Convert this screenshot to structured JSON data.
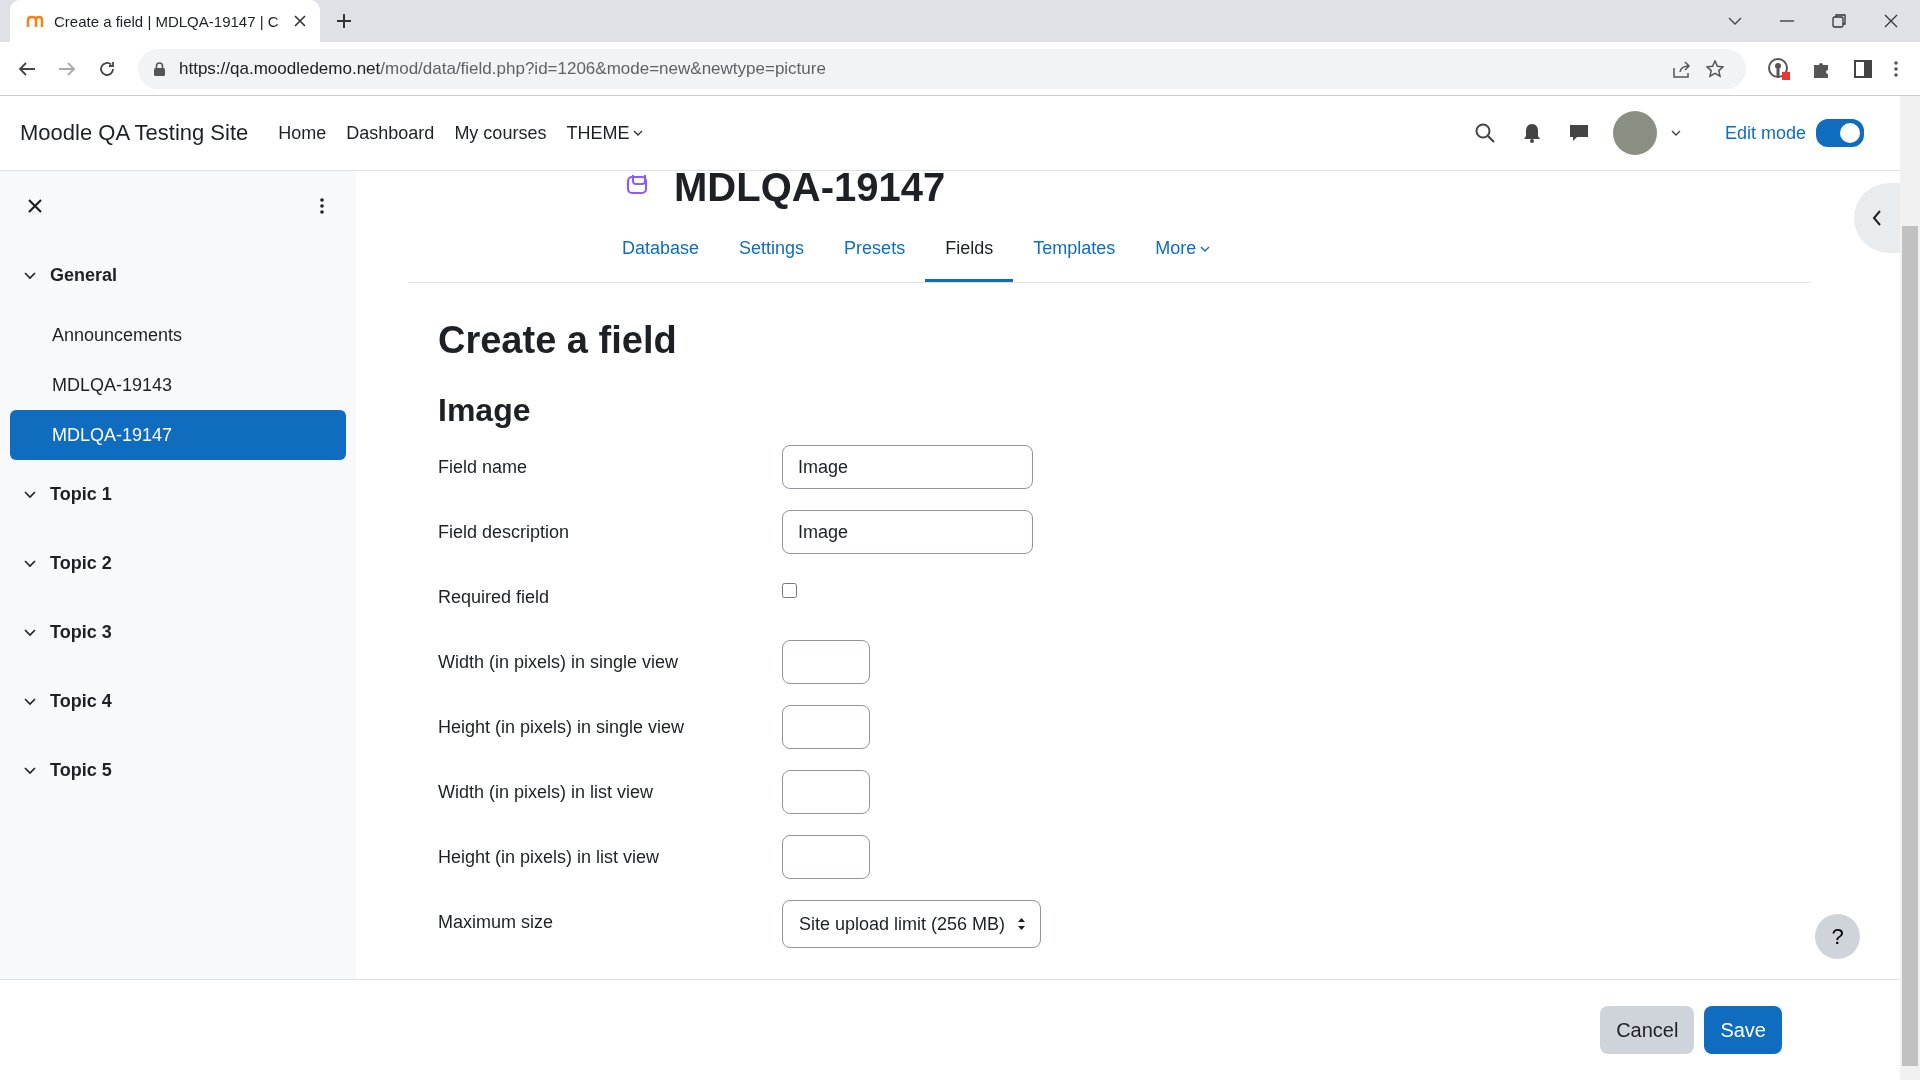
{
  "browser": {
    "tab_title": "Create a field | MDLQA-19147 | C",
    "url_host": "https://qa.moodledemo.net",
    "url_path": "/mod/data/field.php?id=1206&mode=new&newtype=picture"
  },
  "navbar": {
    "site_name": "Moodle QA Testing Site",
    "items": [
      {
        "label": "Home",
        "dropdown": false
      },
      {
        "label": "Dashboard",
        "dropdown": false
      },
      {
        "label": "My courses",
        "dropdown": false
      },
      {
        "label": "THEME",
        "dropdown": true
      }
    ],
    "edit_mode": {
      "label": "Edit mode",
      "on": true
    }
  },
  "sidebar": {
    "items": [
      {
        "kind": "section",
        "label": "General",
        "expanded": true,
        "selected": false
      },
      {
        "kind": "activity",
        "label": "Announcements",
        "selected": false
      },
      {
        "kind": "activity",
        "label": "MDLQA-19143",
        "selected": false
      },
      {
        "kind": "activity",
        "label": "MDLQA-19147",
        "selected": true
      },
      {
        "kind": "section",
        "label": "Topic 1",
        "expanded": true,
        "selected": false
      },
      {
        "kind": "section",
        "label": "Topic 2",
        "expanded": true,
        "selected": false
      },
      {
        "kind": "section",
        "label": "Topic 3",
        "expanded": true,
        "selected": false
      },
      {
        "kind": "section",
        "label": "Topic 4",
        "expanded": true,
        "selected": false
      },
      {
        "kind": "section",
        "label": "Topic 5",
        "expanded": true,
        "selected": false
      }
    ]
  },
  "page": {
    "title": "MDLQA-19147",
    "tabs": [
      {
        "label": "Database",
        "selected": false,
        "dropdown": false
      },
      {
        "label": "Settings",
        "selected": false,
        "dropdown": false
      },
      {
        "label": "Presets",
        "selected": false,
        "dropdown": false
      },
      {
        "label": "Fields",
        "selected": true,
        "dropdown": false
      },
      {
        "label": "Templates",
        "selected": false,
        "dropdown": false
      },
      {
        "label": "More",
        "selected": false,
        "dropdown": true
      }
    ],
    "heading": "Create a field",
    "section": "Image",
    "fields": [
      {
        "kind": "text",
        "label": "Field name",
        "value": "Image"
      },
      {
        "kind": "text",
        "label": "Field description",
        "value": "Image"
      },
      {
        "kind": "checkbox",
        "label": "Required field",
        "checked": false
      },
      {
        "kind": "number",
        "label": "Width (in pixels) in single view"
      },
      {
        "kind": "number",
        "label": "Height (in pixels) in single view"
      },
      {
        "kind": "number",
        "label": "Width (in pixels) in list view"
      },
      {
        "kind": "number",
        "label": "Height (in pixels) in list view"
      },
      {
        "kind": "select",
        "label": "Maximum size",
        "value": "Site upload limit (256 MB)"
      }
    ]
  },
  "footer": {
    "buttons": [
      {
        "label": "Cancel",
        "kind": "secondary"
      },
      {
        "label": "Save",
        "kind": "primary"
      }
    ]
  },
  "help": {
    "label": "?"
  }
}
